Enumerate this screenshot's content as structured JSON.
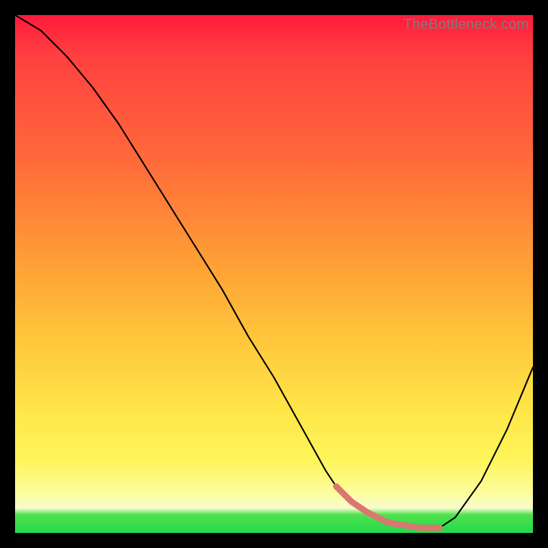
{
  "watermark": "TheBottleneck.com",
  "chart_data": {
    "type": "line",
    "title": "",
    "xlabel": "",
    "ylabel": "",
    "xlim": [
      0,
      100
    ],
    "ylim": [
      0,
      100
    ],
    "x": [
      0,
      5,
      10,
      15,
      20,
      25,
      30,
      35,
      40,
      45,
      50,
      55,
      60,
      62,
      65,
      70,
      75,
      80,
      82,
      85,
      90,
      95,
      100
    ],
    "values": [
      100,
      97,
      92,
      86,
      79,
      71,
      63,
      55,
      47,
      38,
      30,
      21,
      12,
      9,
      6,
      3,
      1.5,
      1,
      1,
      3,
      10,
      20,
      32
    ],
    "highlight": {
      "x": [
        62,
        65,
        68,
        70,
        72,
        75,
        78,
        80,
        82
      ],
      "values": [
        9,
        6,
        4,
        3,
        2,
        1.5,
        1,
        1,
        1
      ]
    },
    "series": [
      {
        "name": "curve",
        "color": "#000000"
      },
      {
        "name": "highlight",
        "color": "#d9726a"
      }
    ]
  }
}
